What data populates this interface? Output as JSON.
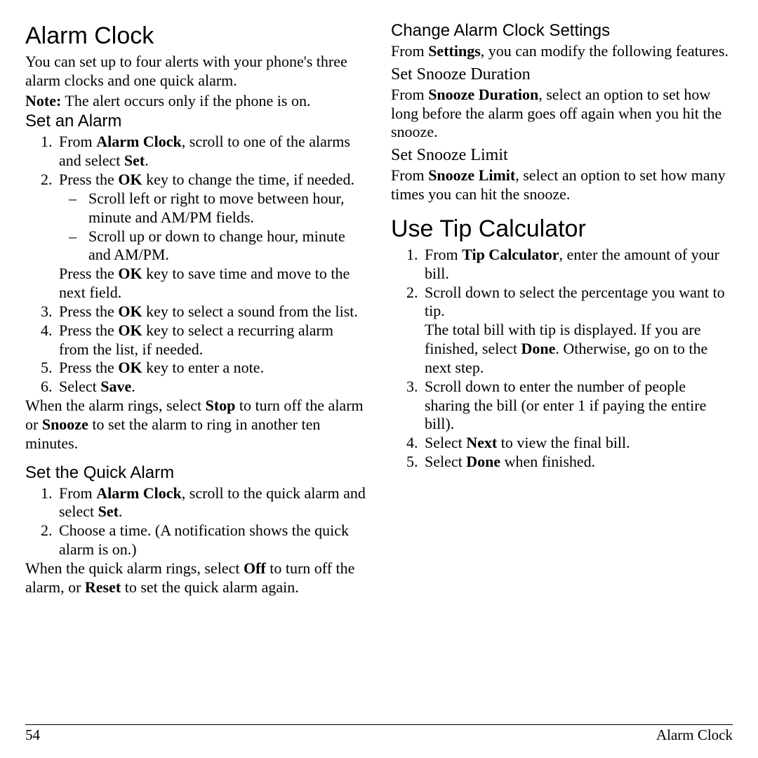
{
  "left": {
    "h1": "Alarm Clock",
    "intro": "You can set up to four alerts with your phone's three alarm clocks and one quick alarm.",
    "note_label": "Note:",
    "note_text": " The alert occurs only if the phone is on.",
    "set_alarm_h": "Set an Alarm",
    "s1_a": "From ",
    "s1_b": "Alarm Clock",
    "s1_c": ", scroll to one of the alarms and select ",
    "s1_d": "Set",
    "s1_e": ".",
    "s2_a": "Press the ",
    "s2_b": "OK",
    "s2_c": " key to change the time, if needed.",
    "s2_sub1": "Scroll left or right to move between hour, minute and AM/PM fields.",
    "s2_sub2": "Scroll up or down to change hour, minute and AM/PM.",
    "s2_after_a": "Press the ",
    "s2_after_b": "OK",
    "s2_after_c": " key to save time and move to the next field.",
    "s3_a": "Press the ",
    "s3_b": "OK",
    "s3_c": " key to select a sound from the list.",
    "s4_a": "Press the ",
    "s4_b": "OK",
    "s4_c": " key to select a recurring alarm from the list, if needed.",
    "s5_a": "Press the ",
    "s5_b": "OK",
    "s5_c": " key to enter a note.",
    "s6_a": "Select ",
    "s6_b": "Save",
    "s6_c": ".",
    "after_a": "When the alarm rings, select ",
    "after_b": "Stop",
    "after_c": " to turn off the alarm or ",
    "after_d": "Snooze",
    "after_e": " to set the alarm to ring in another ten minutes.",
    "quick_h": "Set the Quick Alarm",
    "q1_a": "From ",
    "q1_b": "Alarm Clock",
    "q1_c": ", scroll to the quick alarm and select ",
    "q1_d": "Set",
    "q1_e": ".",
    "q2": "Choose a time. (A notification shows the quick alarm is on.)",
    "qafter_a": "When the quick alarm rings, select ",
    "qafter_b": "Off",
    "qafter_c": " to turn off the alarm, or ",
    "qafter_d": "Reset",
    "qafter_e": " to set the quick alarm again."
  },
  "right": {
    "change_h": "Change Alarm Clock Settings",
    "change_a": "From ",
    "change_b": "Settings",
    "change_c": ", you can modify the following features.",
    "snoozedur_h": "Set Snooze Duration",
    "snoozedur_a": "From ",
    "snoozedur_b": "Snooze Duration",
    "snoozedur_c": ", select an option to set how long before the alarm goes off again when you hit the snooze.",
    "snoozelim_h": "Set Snooze Limit",
    "snoozelim_a": "From ",
    "snoozelim_b": "Snooze Limit",
    "snoozelim_c": ", select an option to set how many times you can hit the snooze.",
    "tip_h": "Use Tip Calculator",
    "t1_a": "From ",
    "t1_b": "Tip Calculator",
    "t1_c": ", enter the amount of your bill.",
    "t2": "Scroll down to select the percentage you want to tip.",
    "t2b_a": "The total bill with tip is displayed. If you are finished, select ",
    "t2b_b": "Done",
    "t2b_c": ". Otherwise, go on to the next step.",
    "t3": "Scroll down to enter the number of people sharing the bill (or enter 1 if paying the entire bill).",
    "t4_a": "Select ",
    "t4_b": "Next",
    "t4_c": " to view the final bill.",
    "t5_a": "Select ",
    "t5_b": "Done",
    "t5_c": " when finished."
  },
  "footer": {
    "page": "54",
    "section": "Alarm Clock"
  }
}
